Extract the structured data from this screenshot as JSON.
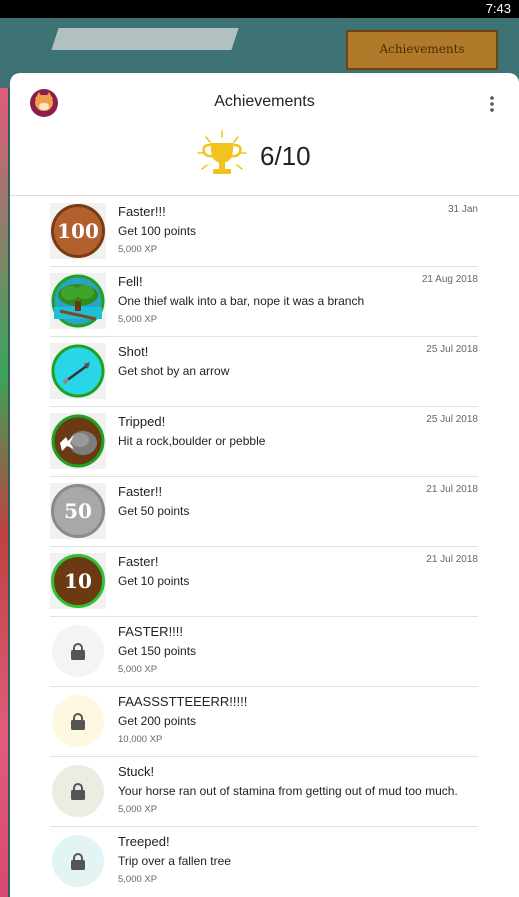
{
  "status_bar": {
    "time": "7:43"
  },
  "background": {
    "button_label": "Achievements"
  },
  "header": {
    "title": "Achievements",
    "progress": "6/10"
  },
  "achievements": [
    {
      "name": "Faster!!!",
      "description": "Get 100 points",
      "xp": "5,000 XP",
      "date": "31 Jan",
      "badge_text": "100",
      "badge_color": "#b3602f",
      "locked": false
    },
    {
      "name": "Fell!",
      "description": "One thief walk into a bar, nope it was a branch",
      "xp": "5,000 XP",
      "date": "21 Aug 2018",
      "badge_text": "",
      "badge_color": "#2aa3c7",
      "locked": false
    },
    {
      "name": "Shot!",
      "description": "Get shot by an arrow",
      "xp": "",
      "date": "25 Jul 2018",
      "badge_text": "",
      "badge_color": "#29d6e8",
      "locked": false
    },
    {
      "name": "Tripped!",
      "description": "Hit a rock,boulder or pebble",
      "xp": "",
      "date": "25 Jul 2018",
      "badge_text": "",
      "badge_color": "#6b3a12",
      "locked": false
    },
    {
      "name": "Faster!!",
      "description": "Get 50 points",
      "xp": "",
      "date": "21 Jul 2018",
      "badge_text": "50",
      "badge_color": "#a8a8a8",
      "locked": false
    },
    {
      "name": "Faster!",
      "description": "Get 10 points",
      "xp": "",
      "date": "21 Jul 2018",
      "badge_text": "10",
      "badge_color": "#6b3a12",
      "locked": false
    },
    {
      "name": "FASTER!!!!",
      "description": "Get 150 points",
      "xp": "5,000 XP",
      "date": "",
      "badge_text": "",
      "badge_color": "#f4f4f4",
      "locked": true
    },
    {
      "name": "FAASSSTTEEERR!!!!!",
      "description": "Get 200 points",
      "xp": "10,000 XP",
      "date": "",
      "badge_text": "",
      "badge_color": "#fdf8df",
      "locked": true
    },
    {
      "name": "Stuck!",
      "description": "Your horse ran out of stamina from getting out of mud too much.",
      "xp": "5,000 XP",
      "date": "",
      "badge_text": "",
      "badge_color": "#ecece3",
      "locked": true
    },
    {
      "name": "Treeped!",
      "description": "Trip over a fallen tree",
      "xp": "5,000 XP",
      "date": "",
      "badge_text": "",
      "badge_color": "#e3f4f4",
      "locked": true
    }
  ],
  "colors": {
    "accent_gold": "#f2c31c",
    "ring_green": "#2fc234",
    "text": "#222222"
  }
}
